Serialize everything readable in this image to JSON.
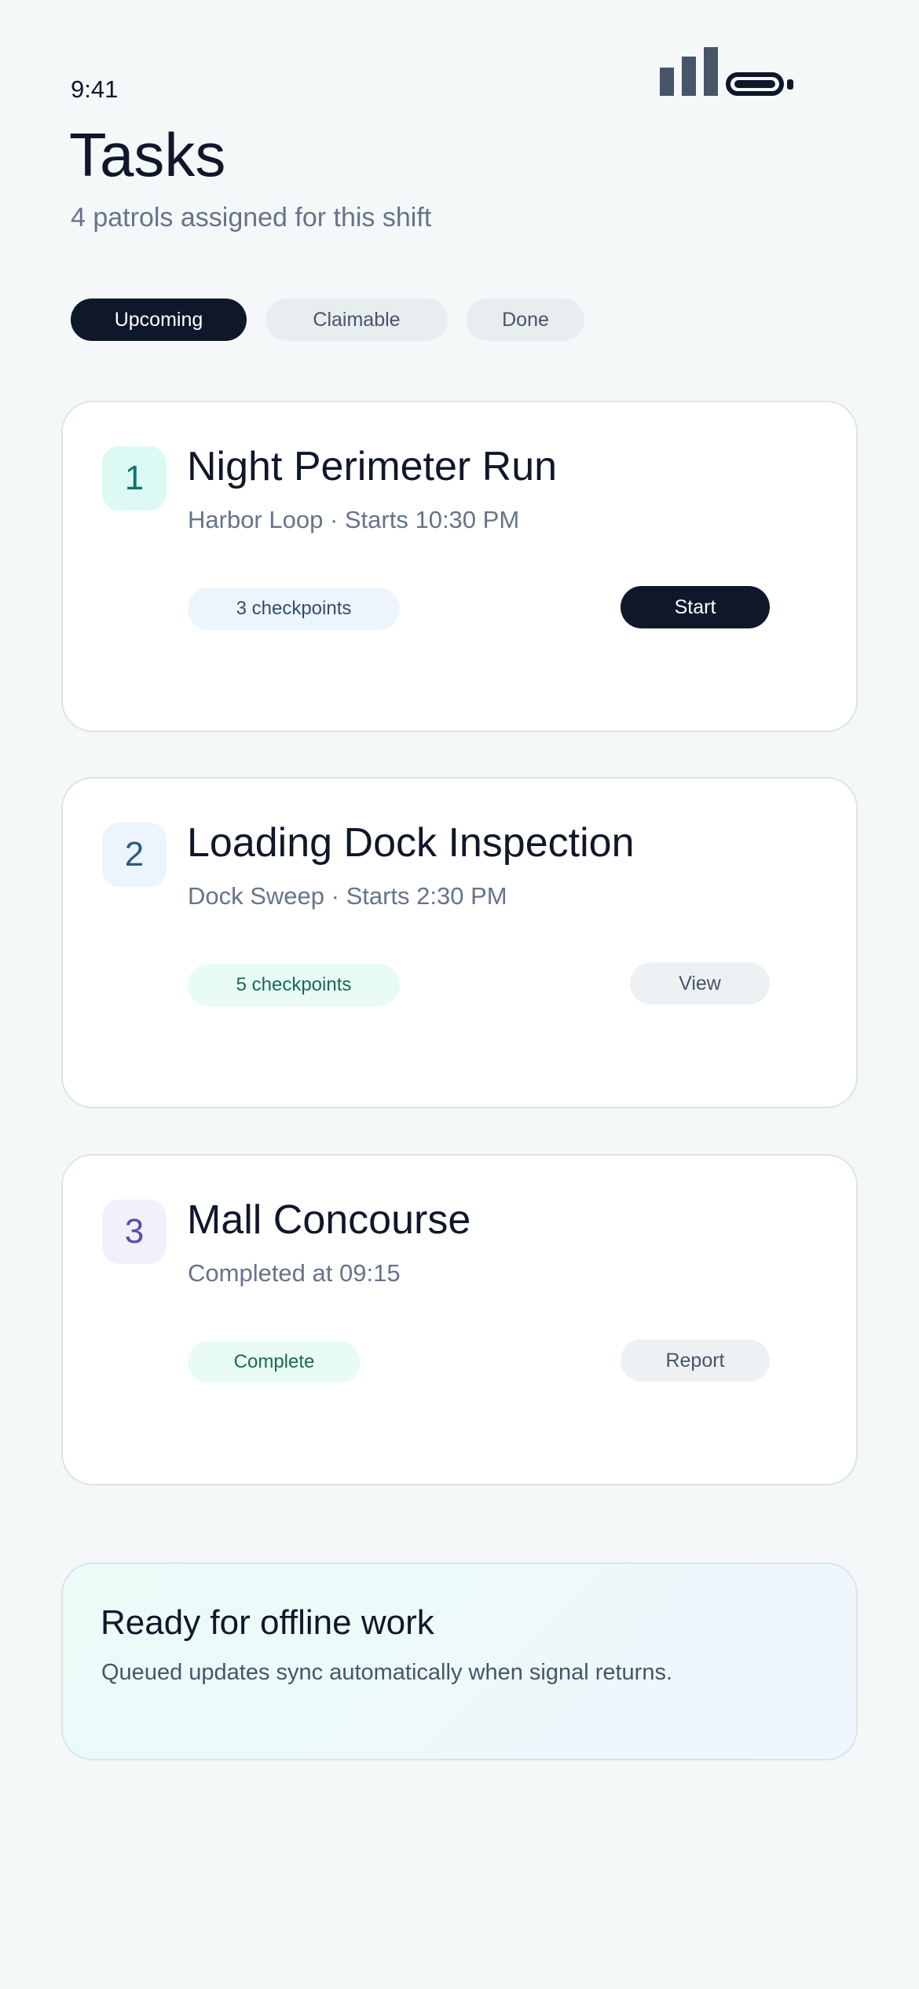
{
  "status_bar": {
    "time": "9:41",
    "signal_icon": "signal-bars-icon",
    "battery_icon": "battery-icon"
  },
  "header": {
    "title": "Tasks",
    "subtitle": "4 patrols assigned for this shift"
  },
  "tabs": [
    {
      "label": "Upcoming",
      "active": true
    },
    {
      "label": "Claimable",
      "active": false
    },
    {
      "label": "Done",
      "active": false
    }
  ],
  "tasks": [
    {
      "number": "1",
      "title": "Night Perimeter Run",
      "subtitle": "Harbor Loop · Starts 10:30 PM",
      "chip": "3 checkpoints",
      "action": "Start",
      "badge_color": "#dcfaf3",
      "badge_text_color": "#0f766e",
      "chip_color": "#ecf5fe",
      "chip_text_color": "#334e6b"
    },
    {
      "number": "2",
      "title": "Loading Dock Inspection",
      "subtitle": "Dock Sweep · Starts 2:30 PM",
      "chip": "5 checkpoints",
      "action": "View",
      "badge_color": "#edf4fd",
      "badge_text_color": "#2c5a80",
      "chip_color": "#e9fbf5",
      "chip_text_color": "#166b52"
    },
    {
      "number": "3",
      "title": "Mall Concourse",
      "subtitle": "Completed at 09:15",
      "chip": "Complete",
      "action": "Report",
      "badge_color": "#f2f0fd",
      "badge_text_color": "#5b4bb0",
      "chip_color": "#e9fbf5",
      "chip_text_color": "#166b52"
    }
  ],
  "offline_banner": {
    "title": "Ready for offline work",
    "text": "Queued updates sync automatically when signal returns."
  },
  "colors": {
    "background": "#f5f8f8",
    "primary": "#0f172a",
    "muted": "#64748b",
    "card_border": "#dbe4e8"
  }
}
